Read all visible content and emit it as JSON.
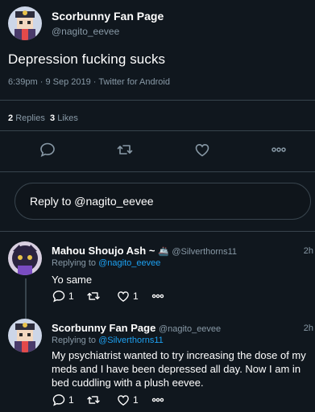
{
  "tweet": {
    "author_name": "Scorbunny Fan Page",
    "author_handle": "@nagito_eevee",
    "text": "Depression fucking sucks",
    "meta": "6:39pm · 9 Sep 2019 · Twitter for Android",
    "replies_count": "2",
    "replies_label": "Replies",
    "likes_count": "3",
    "likes_label": "Likes"
  },
  "actions": [
    "reply-icon",
    "retweet-icon",
    "like-icon",
    "more-icon"
  ],
  "reply_box": {
    "placeholder": "Reply to @nagito_eevee"
  },
  "replies": [
    {
      "name": "Mahou Shoujo Ash ~",
      "name_emoji": "🚢",
      "handle": "@Silverthorns11",
      "time": "2h",
      "replying_prefix": "Replying to",
      "replying_to": "@nagito_eevee",
      "text": "Yo same",
      "reply_count": "1",
      "like_count": "1"
    },
    {
      "name": "Scorbunny Fan Page",
      "handle": "@nagito_eevee",
      "time": "2h",
      "replying_prefix": "Replying to",
      "replying_to": "@Silverthorns11",
      "text": "My psychiatrist wanted to try increasing the dose of my meds and I have been depressed all day. Now I am in bed cuddling with a plush eevee.",
      "reply_count": "1",
      "like_count": "1"
    }
  ],
  "colors": {
    "background": "#10171e",
    "divider": "#38444d",
    "secondary_text": "#8899a6",
    "link": "#1da1f2"
  }
}
